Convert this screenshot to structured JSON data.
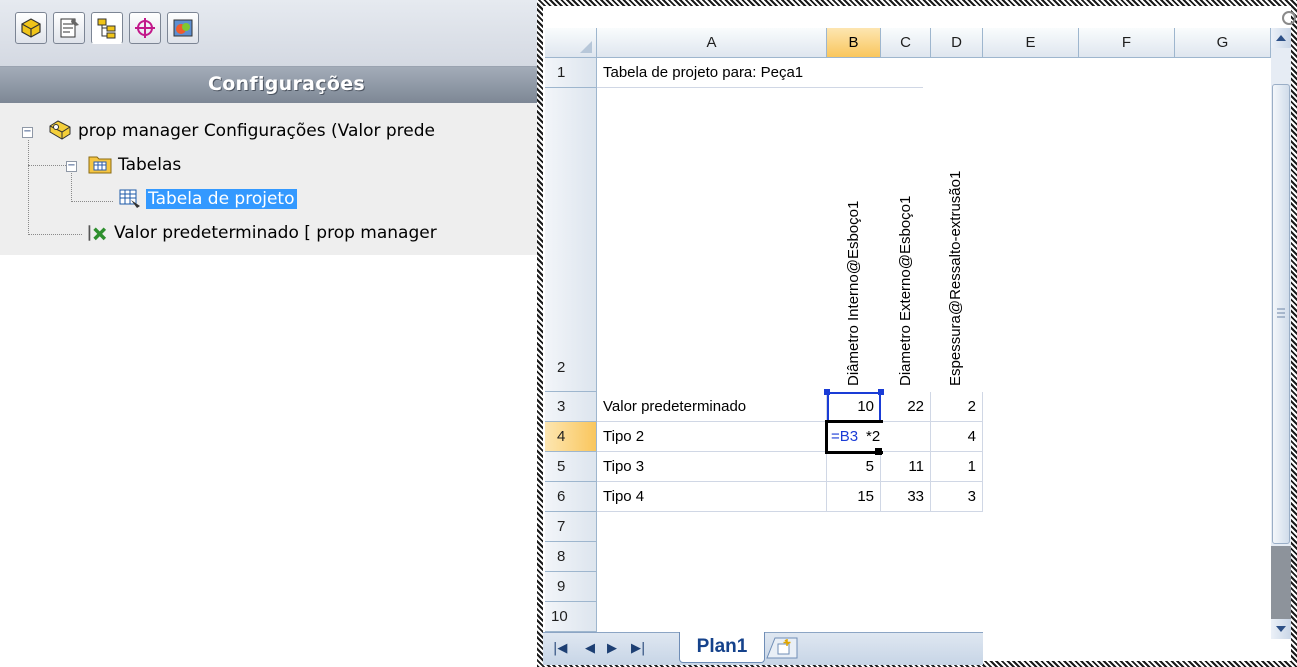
{
  "config_manager": {
    "header_title": "Configurações",
    "tabs": [
      {
        "icon": "feature-manager-icon",
        "active": false
      },
      {
        "icon": "property-manager-icon",
        "active": false
      },
      {
        "icon": "configuration-manager-icon",
        "active": true
      },
      {
        "icon": "dimxpert-manager-icon",
        "active": false
      },
      {
        "icon": "display-manager-icon",
        "active": false
      }
    ],
    "tree": {
      "root_label": "prop manager Configurações  (Valor prede",
      "folder_label": "Tabelas",
      "design_table_label": "Tabela de projeto",
      "config_label": "Valor predeterminado [ prop manager"
    }
  },
  "excel": {
    "columns": [
      "A",
      "B",
      "C",
      "D",
      "E",
      "F",
      "G"
    ],
    "active_column": "B",
    "active_row": "4",
    "rows": [
      "1",
      "2",
      "3",
      "4",
      "5",
      "6",
      "7",
      "8",
      "9",
      "10"
    ],
    "title_cell": "Tabela de projeto para: Peça1",
    "param_headers": {
      "b": "Diâmetro Interno@Esboço1",
      "c": "Diametro Externo@Esboço1",
      "d": "Espessura@Ressalto-extrusão1"
    },
    "table_rows": [
      {
        "name": "Valor predeterminado",
        "b": "10",
        "c": "22",
        "d": "2"
      },
      {
        "name": "Tipo 2",
        "b": "",
        "c": "",
        "d": "4"
      },
      {
        "name": "Tipo 3",
        "b": "5",
        "c": "11",
        "d": "1"
      },
      {
        "name": "Tipo 4",
        "b": "15",
        "c": "33",
        "d": "3"
      }
    ],
    "formula_ref": "=B3",
    "formula_rest": "*2",
    "sheet_tab": "Plan1",
    "colors": {
      "selection": "#1a3cd6",
      "active_header": "#f9c65d",
      "sheet_tab_text": "#15428b"
    }
  }
}
